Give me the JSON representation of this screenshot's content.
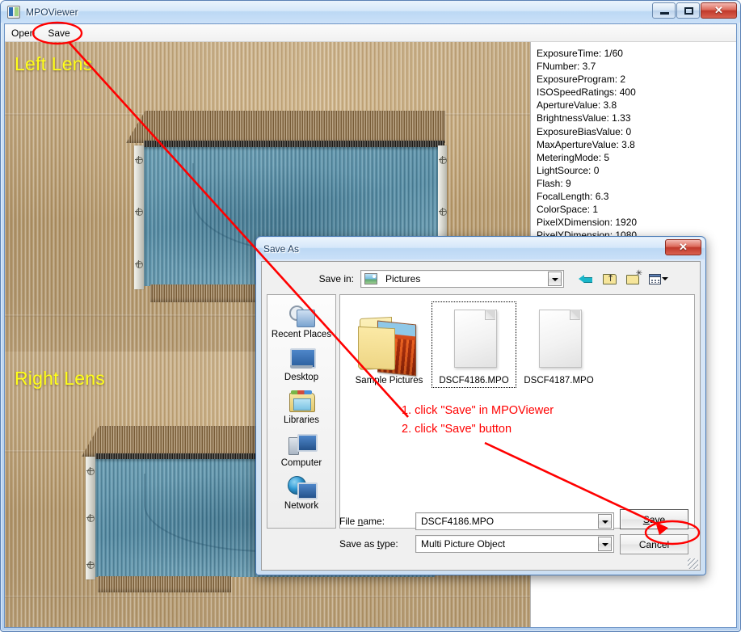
{
  "window": {
    "title": "MPOViewer",
    "icon": "mpo-app-icon",
    "caption_buttons": {
      "minimize": "minimize-icon",
      "maximize": "maximize-icon",
      "close": "✕"
    }
  },
  "menubar": {
    "items": [
      {
        "label": "Open",
        "name": "menu-open"
      },
      {
        "label": "Save",
        "name": "menu-save"
      }
    ]
  },
  "viewer": {
    "left_label": "Left Lens",
    "right_label": "Right Lens"
  },
  "exif": {
    "lines": [
      "ExposureTime: 1/60",
      "FNumber: 3.7",
      "ExposureProgram: 2",
      "ISOSpeedRatings: 400",
      "ApertureValue: 3.8",
      "BrightnessValue: 1.33",
      "ExposureBiasValue: 0",
      "MaxApertureValue: 3.8",
      "MeteringMode: 5",
      "LightSource: 0",
      "Flash: 9",
      "FocalLength: 6.3",
      "ColorSpace: 1",
      "PixelXDimension: 1920",
      "PixelYDimension: 1080"
    ]
  },
  "dialog": {
    "title": "Save As",
    "close_label": "✕",
    "save_in": {
      "label": "Save in:",
      "value": "Pictures"
    },
    "toolbar": [
      {
        "name": "back-icon",
        "tooltip": "Back"
      },
      {
        "name": "up-folder-icon",
        "tooltip": "Up One Level"
      },
      {
        "name": "new-folder-icon",
        "tooltip": "Create New Folder"
      },
      {
        "name": "views-icon",
        "tooltip": "Views"
      }
    ],
    "places": [
      {
        "label": "Recent Places",
        "icon": "recent-places-icon"
      },
      {
        "label": "Desktop",
        "icon": "desktop-icon"
      },
      {
        "label": "Libraries",
        "icon": "libraries-icon"
      },
      {
        "label": "Computer",
        "icon": "computer-icon"
      },
      {
        "label": "Network",
        "icon": "network-icon"
      }
    ],
    "files": [
      {
        "label": "Sample Pictures",
        "type": "folder",
        "focused": false
      },
      {
        "label": "DSCF4186.MPO",
        "type": "document",
        "focused": true
      },
      {
        "label": "DSCF4187.MPO",
        "type": "document",
        "focused": false
      }
    ],
    "file_name": {
      "label_pre": "File ",
      "label_underline": "n",
      "label_post": "ame:",
      "value": "DSCF4186.MPO"
    },
    "save_as_type": {
      "label_pre": "Save as ",
      "label_underline": "t",
      "label_post": "ype:",
      "value": "Multi Picture Object"
    },
    "buttons": {
      "save_pre": "",
      "save_underline": "S",
      "save_post": "ave",
      "cancel": "Cancel"
    }
  },
  "annotations": {
    "color": "#ff0000",
    "steps": [
      "1. click \"Save\" in MPOViewer",
      "2. click \"Save\" button"
    ]
  }
}
